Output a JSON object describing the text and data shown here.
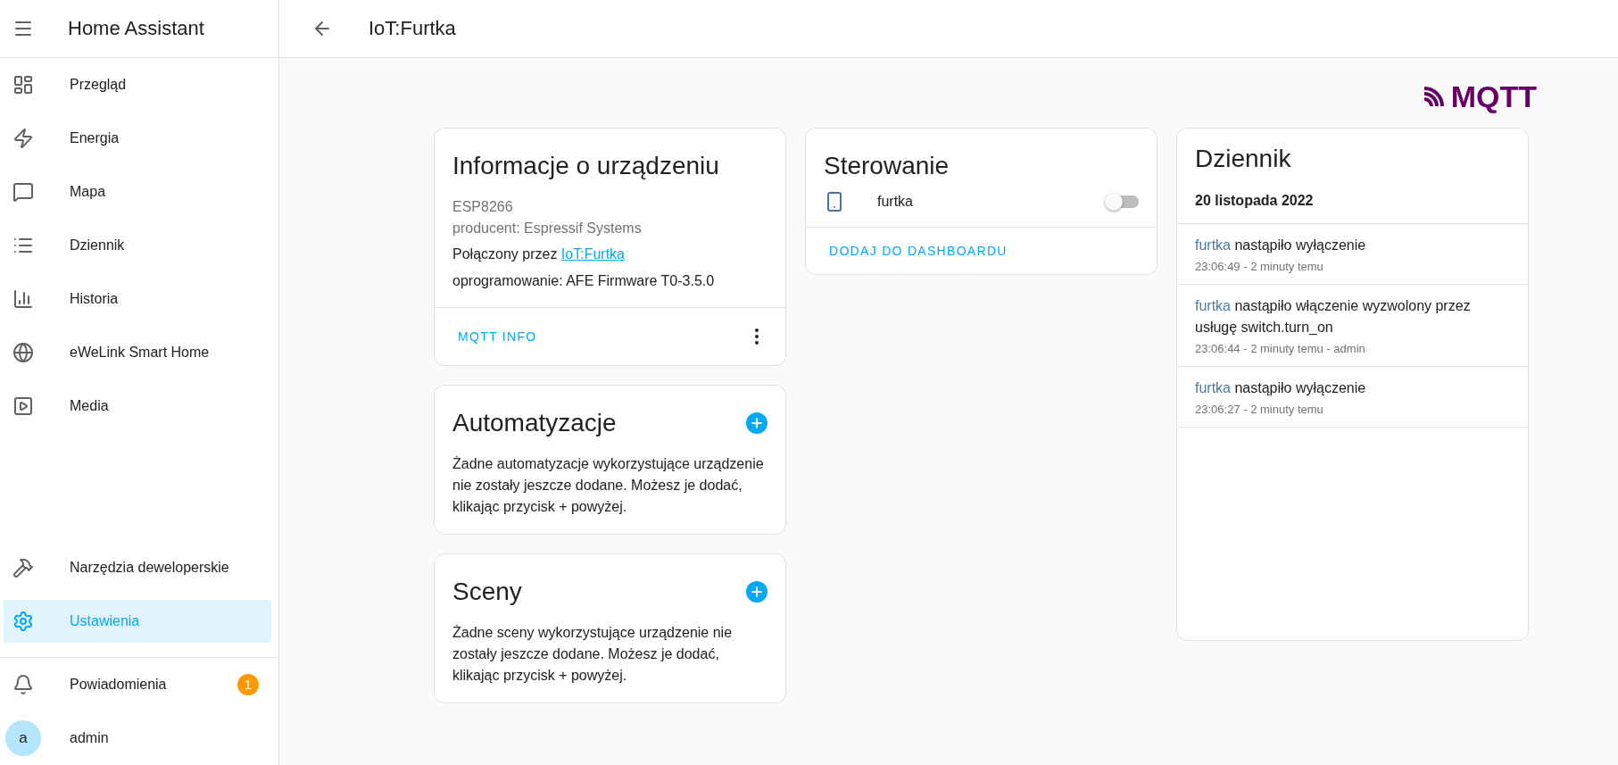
{
  "sidebar": {
    "title": "Home Assistant",
    "items": [
      {
        "label": "Przegląd",
        "kind": "dashboard",
        "selected": false
      },
      {
        "label": "Energia",
        "kind": "energy",
        "selected": false
      },
      {
        "label": "Mapa",
        "kind": "map",
        "selected": false
      },
      {
        "label": "Dziennik",
        "kind": "logbook",
        "selected": false
      },
      {
        "label": "Historia",
        "kind": "history",
        "selected": false
      },
      {
        "label": "eWeLink Smart Home",
        "kind": "web",
        "selected": false
      },
      {
        "label": "Media",
        "kind": "media",
        "selected": false
      }
    ],
    "bottom_items": [
      {
        "label": "Narzędzia deweloperskie",
        "kind": "tools",
        "selected": false
      },
      {
        "label": "Ustawienia",
        "kind": "settings",
        "selected": true
      }
    ],
    "notifications": {
      "label": "Powiadomienia",
      "badge": "1"
    },
    "user": {
      "initial": "a",
      "name": "admin"
    }
  },
  "header": {
    "title": "IoT:Furtka"
  },
  "brand": {
    "logo": "MQTT"
  },
  "device_info": {
    "title": "Informacje o urządzeniu",
    "model": "ESP8266",
    "manufacturer": "producent: Espressif Systems",
    "connected_prefix": "Połączony przez",
    "connected_link": "IoT:Furtka",
    "firmware": "oprogramowanie: AFE Firmware T0-3.5.0",
    "action": "MQTT INFO"
  },
  "control": {
    "title": "Sterowanie",
    "entities": [
      {
        "name": "furtka",
        "on": false
      }
    ],
    "action": "DODAJ DO DASHBOARDU"
  },
  "automations": {
    "title": "Automatyzacje",
    "text": "Żadne automatyzacje wykorzystujące urządzenie nie zostały jeszcze dodane. Możesz je dodać, klikając przycisk + powyżej."
  },
  "scenes": {
    "title": "Sceny",
    "text": "Żadne sceny wykorzystujące urządzenie nie zostały jeszcze dodane. Możesz je dodać, klikając przycisk + powyżej."
  },
  "logbook": {
    "title": "Dziennik",
    "date": "20 listopada 2022",
    "entries": [
      {
        "entity": "furtka",
        "message": "nastąpiło wyłączenie",
        "time": "23:06:49 - 2 minuty temu"
      },
      {
        "entity": "furtka",
        "message": "nastąpiło włączenie wyzwolony przez usługę switch.turn_on",
        "time": "23:06:44 - 2 minuty temu - admin"
      },
      {
        "entity": "furtka",
        "message": "nastąpiło wyłączenie",
        "time": "23:06:27 - 2 minuty temu"
      }
    ]
  }
}
